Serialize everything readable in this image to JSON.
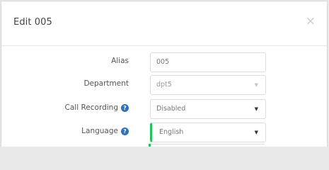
{
  "modal": {
    "title": "Edit 005",
    "close_icon": "×"
  },
  "form": {
    "alias": {
      "label": "Alias",
      "value": "005"
    },
    "department": {
      "label": "Department",
      "value": "dpt5"
    },
    "call_recording": {
      "label": "Call Recording",
      "value": "Disabled",
      "help_icon": "question-circle-icon"
    },
    "language": {
      "label": "Language",
      "value": "English",
      "help_icon": "question-circle-icon"
    }
  },
  "colors": {
    "help_icon": "#2f72b8",
    "valid_indicator": "#21c25e"
  }
}
